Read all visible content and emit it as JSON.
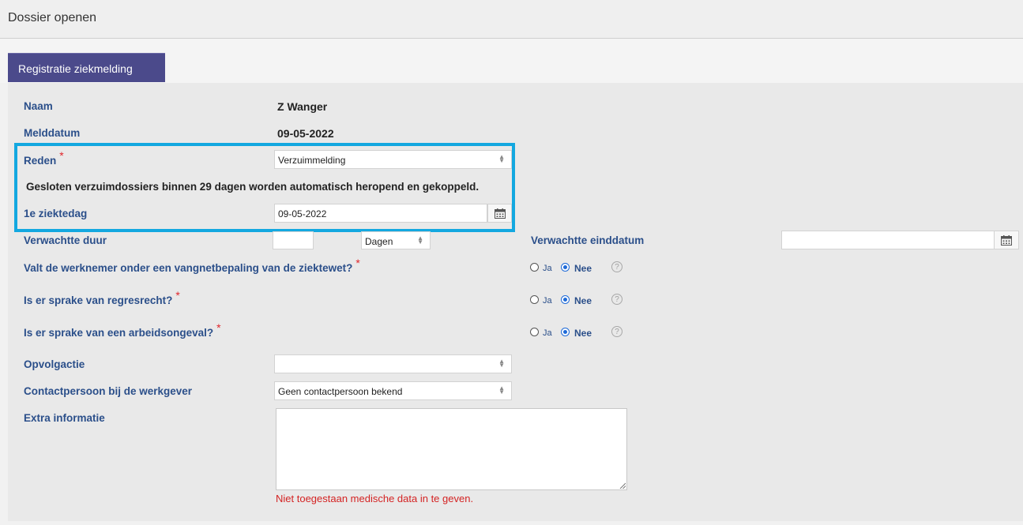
{
  "header": {
    "title": "Dossier openen"
  },
  "tab": {
    "label": "Registratie ziekmelding"
  },
  "form": {
    "naam": {
      "label": "Naam",
      "value": "Z Wanger"
    },
    "melddatum": {
      "label": "Melddatum",
      "value": "09-05-2022"
    },
    "reden": {
      "label": "Reden",
      "required": "*",
      "value": "Verzuimmelding"
    },
    "notice": "Gesloten verzuimdossiers binnen 29 dagen worden automatisch heropend en gekoppeld.",
    "eerste_ziektedag": {
      "label": "1e ziektedag",
      "value": "09-05-2022"
    },
    "verwachte_duur": {
      "label": "Verwachtte duur",
      "value": "",
      "unit": "Dagen"
    },
    "verwachte_einddatum": {
      "label": "Verwachtte einddatum",
      "value": ""
    },
    "vangnet": {
      "label": "Valt de werknemer onder een vangnetbepaling van de ziektewet?",
      "required": "*",
      "ja": "Ja",
      "nee": "Nee",
      "selected": "Nee",
      "help": "?"
    },
    "regresrecht": {
      "label": "Is er sprake van regresrecht?",
      "required": "*",
      "ja": "Ja",
      "nee": "Nee",
      "selected": "Nee",
      "help": "?"
    },
    "arbeidsongeval": {
      "label": "Is er sprake van een arbeidsongeval?",
      "required": "*",
      "ja": "Ja",
      "nee": "Nee",
      "selected": "Nee",
      "help": "?"
    },
    "opvolgactie": {
      "label": "Opvolgactie",
      "value": ""
    },
    "contactpersoon": {
      "label": "Contactpersoon bij de werkgever",
      "value": "Geen contactpersoon bekend"
    },
    "extra_informatie": {
      "label": "Extra informatie",
      "value": "",
      "warning": "Niet toegestaan medische data in te geven."
    }
  },
  "colors": {
    "tab_bg": "#4b4a8b",
    "label": "#2b4f8a",
    "highlight": "#13a8e0",
    "required": "#e0262b",
    "warning": "#d42323",
    "radio": "#1e6ad8"
  }
}
